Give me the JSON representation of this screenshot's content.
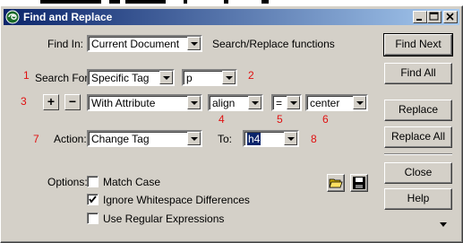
{
  "window": {
    "title": "Find and Replace"
  },
  "find_in": {
    "label": "Find In:",
    "value": "Current Document",
    "note": "Search/Replace functions"
  },
  "search_for": {
    "label": "Search For:",
    "type_value": "Specific Tag",
    "tag_value": "p"
  },
  "attribute": {
    "plus_label": "+",
    "minus_label": "−",
    "condition_value": "With Attribute",
    "name_value": "align",
    "operator_value": "=",
    "value_value": "center"
  },
  "action": {
    "label": "Action:",
    "value": "Change Tag",
    "to_label": "To:",
    "to_value": "h4"
  },
  "callouts": {
    "n1": "1",
    "n2": "2",
    "n3": "3",
    "n4": "4",
    "n5": "5",
    "n6": "6",
    "n7": "7",
    "n8": "8"
  },
  "options": {
    "label": "Options:",
    "match_case": {
      "label": "Match Case",
      "checked": false
    },
    "ignore_whitespace": {
      "label": "Ignore Whitespace Differences",
      "checked": true
    },
    "regex": {
      "label": "Use Regular Expressions",
      "checked": false
    }
  },
  "buttons": {
    "find_next": "Find Next",
    "find_all": "Find All",
    "replace": "Replace",
    "replace_all": "Replace All",
    "close": "Close",
    "help": "Help"
  },
  "icons": {
    "app": "dreamweaver-swirl-icon",
    "open": "open-folder-icon",
    "save": "save-disk-icon",
    "more": "triangle-down-icon"
  }
}
